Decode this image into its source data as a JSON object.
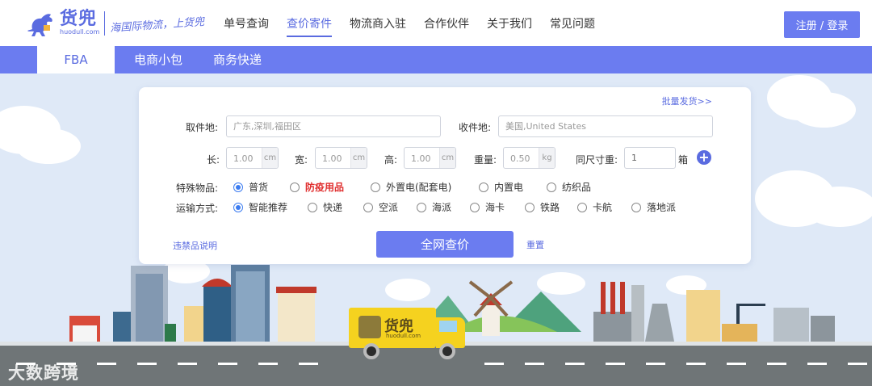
{
  "header": {
    "brand": "货兜",
    "domain": "huodull.com",
    "slogan": "海国际物流，上货兜",
    "nav": [
      {
        "label": "单号查询"
      },
      {
        "label": "查价寄件"
      },
      {
        "label": "物流商入驻"
      },
      {
        "label": "合作伙伴"
      },
      {
        "label": "关于我们"
      },
      {
        "label": "常见问题"
      }
    ],
    "active_nav": "查价寄件",
    "login_label": "注册 / 登录"
  },
  "tabs": [
    {
      "label": "FBA"
    },
    {
      "label": "电商小包"
    },
    {
      "label": "商务快递"
    }
  ],
  "active_tab": "FBA",
  "form": {
    "batch_link": "批量发货>>",
    "pickup_label": "取件地:",
    "pickup_placeholder": "广东,深圳,福田区",
    "delivery_label": "收件地:",
    "delivery_placeholder": "美国,United States",
    "length_label": "长:",
    "length_value": "1.00",
    "width_label": "宽:",
    "width_value": "1.00",
    "height_label": "高:",
    "height_value": "1.00",
    "dim_unit": "cm",
    "weight_label": "重量:",
    "weight_value": "0.50",
    "weight_unit": "kg",
    "same_size_label": "同尺寸重:",
    "same_size_value": "1",
    "box_unit": "箱",
    "add_icon": "+",
    "special_label": "特殊物品:",
    "special_options": [
      "普货",
      "防疫用品",
      "外置电(配套电)",
      "内置电",
      "纺织品"
    ],
    "special_selected": "普货",
    "transport_label": "运输方式:",
    "transport_options": [
      "智能推荐",
      "快递",
      "空派",
      "海派",
      "海卡",
      "铁路",
      "卡航",
      "落地派"
    ],
    "transport_selected": "智能推荐",
    "prohibited_link": "违禁品说明",
    "submit_label": "全网查价",
    "reset_label": "重置"
  },
  "truck_brand": "货兜",
  "truck_domain": "huodull.com",
  "watermark": "大数跨境",
  "colors": {
    "accent": "#6b7cf0",
    "brand": "#5a6be0",
    "warn": "#e03030",
    "road": "#6f7577",
    "truck": "#f5d21f"
  }
}
